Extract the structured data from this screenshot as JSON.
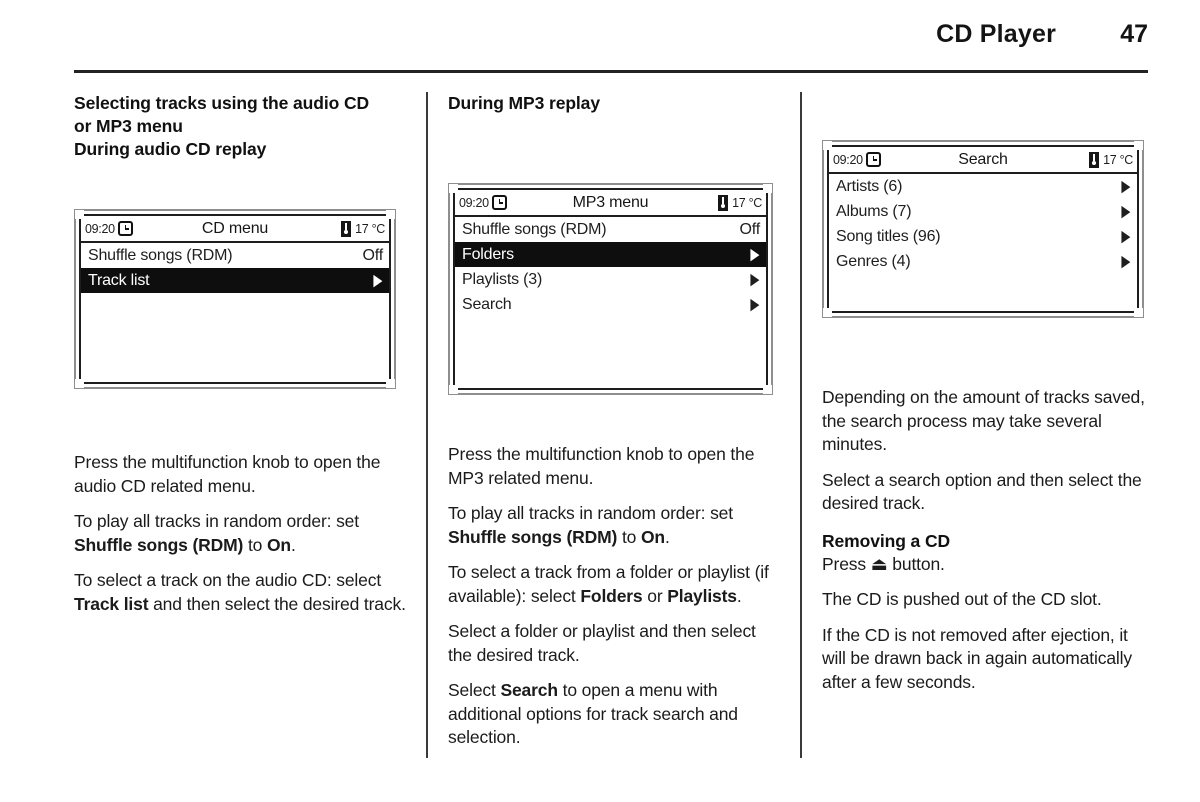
{
  "header": {
    "title": "CD Player",
    "page_number": "47"
  },
  "columns": {
    "left": {
      "section_title_line1": "Selecting tracks using the audio CD",
      "section_title_line2": "or MP3 menu",
      "sub_title": "During audio CD replay",
      "display": {
        "name": "cd-menu",
        "status": {
          "clock": "09:20",
          "clock_icon": "clock-icon",
          "title": "CD menu",
          "thermometer_icon": "thermometer-icon",
          "temperature": "17 °C"
        },
        "rows": [
          {
            "label": "Shuffle songs (RDM)",
            "value": "Off",
            "arrow": "",
            "selected": false
          },
          {
            "label": "Track list",
            "value": "",
            "arrow": "▶",
            "selected": true
          }
        ]
      },
      "paragraphs": [
        {
          "parts": [
            {
              "text": "Press the multifunction knob to open the audio CD related menu.",
              "bold": false
            }
          ]
        },
        {
          "parts": [
            {
              "text": "To play all tracks in random order: set ",
              "bold": false
            },
            {
              "text": "Shuffle songs (RDM)",
              "bold": true
            },
            {
              "text": " to ",
              "bold": false
            },
            {
              "text": "On",
              "bold": true
            },
            {
              "text": ".",
              "bold": false
            }
          ]
        },
        {
          "parts": [
            {
              "text": "To select a track on the audio CD: select ",
              "bold": false
            },
            {
              "text": "Track list",
              "bold": true
            },
            {
              "text": " and then select the desired track.",
              "bold": false
            }
          ]
        }
      ]
    },
    "middle": {
      "sub_title": "During MP3 replay",
      "display": {
        "name": "mp3-menu",
        "status": {
          "clock": "09:20",
          "clock_icon": "clock-icon",
          "title": "MP3 menu",
          "thermometer_icon": "thermometer-icon",
          "temperature": "17 °C"
        },
        "rows": [
          {
            "label": "Shuffle songs (RDM)",
            "value": "Off",
            "arrow": "",
            "selected": false
          },
          {
            "label": "Folders",
            "value": "",
            "arrow": "▶",
            "selected": true
          },
          {
            "label": "Playlists (3)",
            "value": "",
            "arrow": "▶",
            "selected": false
          },
          {
            "label": "Search",
            "value": "",
            "arrow": "▶",
            "selected": false
          }
        ]
      },
      "paragraphs": [
        {
          "parts": [
            {
              "text": "Press the multifunction knob to open the MP3 related menu.",
              "bold": false
            }
          ]
        },
        {
          "parts": [
            {
              "text": "To play all tracks in random order: set ",
              "bold": false
            },
            {
              "text": "Shuffle songs (RDM)",
              "bold": true
            },
            {
              "text": " to ",
              "bold": false
            },
            {
              "text": "On",
              "bold": true
            },
            {
              "text": ".",
              "bold": false
            }
          ]
        },
        {
          "parts": [
            {
              "text": "To select a track from a folder or playlist (if available): select ",
              "bold": false
            },
            {
              "text": "Folders",
              "bold": true
            },
            {
              "text": " or ",
              "bold": false
            },
            {
              "text": "Playlists",
              "bold": true
            },
            {
              "text": ".",
              "bold": false
            }
          ]
        },
        {
          "parts": [
            {
              "text": "Select a folder or playlist and then select the desired track.",
              "bold": false
            }
          ]
        },
        {
          "parts": [
            {
              "text": "Select ",
              "bold": false
            },
            {
              "text": "Search",
              "bold": true
            },
            {
              "text": " to open a menu with additional options for track search and selection.",
              "bold": false
            }
          ]
        }
      ]
    },
    "right": {
      "display": {
        "name": "search-menu",
        "status": {
          "clock": "09:20",
          "clock_icon": "clock-icon",
          "title": "Search",
          "thermometer_icon": "thermometer-icon",
          "temperature": "17 °C"
        },
        "rows": [
          {
            "label": "Artists (6)",
            "value": "",
            "arrow": "▶",
            "selected": false
          },
          {
            "label": "Albums (7)",
            "value": "",
            "arrow": "▶",
            "selected": false
          },
          {
            "label": "Song titles (96)",
            "value": "",
            "arrow": "▶",
            "selected": false
          },
          {
            "label": "Genres (4)",
            "value": "",
            "arrow": "▶",
            "selected": false
          }
        ]
      },
      "paragraphs_top": [
        {
          "parts": [
            {
              "text": "Depending on the amount of tracks saved, the search process may take several minutes.",
              "bold": false
            }
          ]
        },
        {
          "parts": [
            {
              "text": "Select a search option and then select the desired track.",
              "bold": false
            }
          ]
        }
      ],
      "sub_title": "Removing a CD",
      "paragraphs_bottom": [
        {
          "parts": [
            {
              "text": "Press ",
              "bold": false
            },
            {
              "text": "⏏",
              "bold": false
            },
            {
              "text": " button.",
              "bold": false
            }
          ]
        },
        {
          "parts": [
            {
              "text": "The CD is pushed out of the CD slot.",
              "bold": false
            }
          ]
        },
        {
          "parts": [
            {
              "text": "If the CD is not removed after ejection, it will be drawn back in again automatically after a few seconds.",
              "bold": false
            }
          ]
        }
      ]
    }
  }
}
